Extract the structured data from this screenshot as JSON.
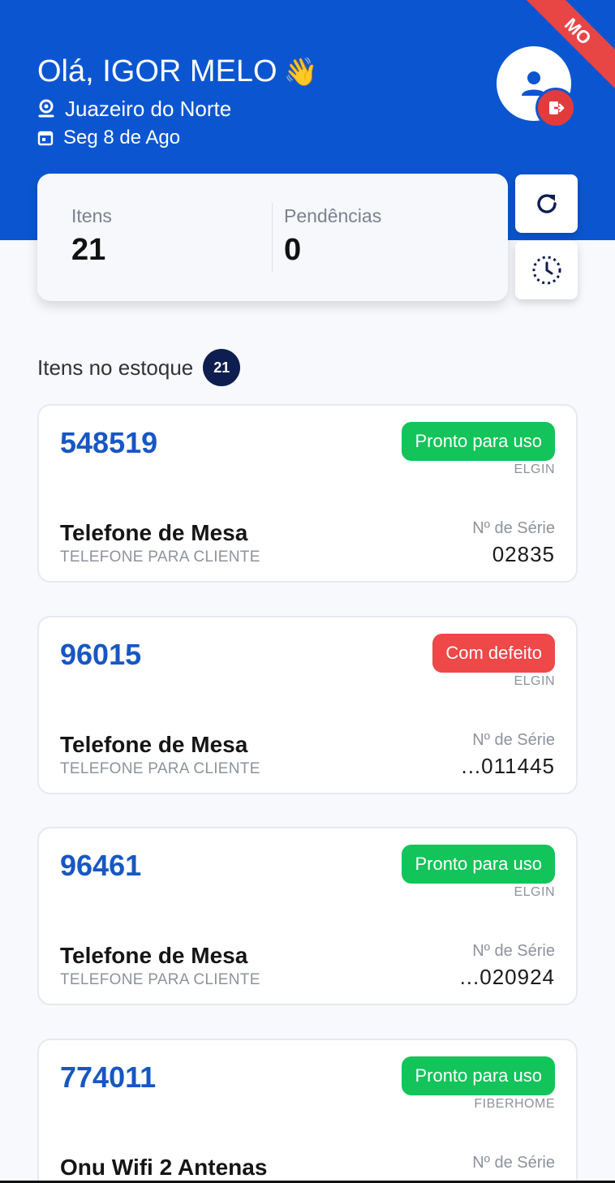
{
  "ribbon": {
    "label": "MO"
  },
  "header": {
    "greeting": "Olá, IGOR MELO",
    "greeting_emoji": "👋",
    "city": "Juazeiro do Norte",
    "date": "Seg 8 de Ago"
  },
  "stats": {
    "items_label": "Itens",
    "items_value": "21",
    "pending_label": "Pendências",
    "pending_value": "0"
  },
  "section": {
    "title": "Itens no estoque",
    "count": "21"
  },
  "colors": {
    "brand_blue": "#0b56d0",
    "status_ok": "#12c45a",
    "status_bad": "#ee4848",
    "id_blue": "#1757c4"
  },
  "items": [
    {
      "id": "548519",
      "status": "Pronto para uso",
      "status_kind": "ok",
      "brand": "ELGIN",
      "name": "Telefone de Mesa",
      "type": "TELEFONE PARA CLIENTE",
      "serial_label": "Nº de Série",
      "serial": "02835"
    },
    {
      "id": "96015",
      "status": "Com defeito",
      "status_kind": "bad",
      "brand": "ELGIN",
      "name": "Telefone de Mesa",
      "type": "TELEFONE PARA CLIENTE",
      "serial_label": "Nº de Série",
      "serial": "...011445"
    },
    {
      "id": "96461",
      "status": "Pronto para uso",
      "status_kind": "ok",
      "brand": "ELGIN",
      "name": "Telefone de Mesa",
      "type": "TELEFONE PARA CLIENTE",
      "serial_label": "Nº de Série",
      "serial": "...020924"
    },
    {
      "id": "774011",
      "status": "Pronto para uso",
      "status_kind": "ok",
      "brand": "FIBERHOME",
      "name": "Onu Wifi 2 Antenas",
      "type": "",
      "serial_label": "Nº de Série",
      "serial": ""
    }
  ]
}
